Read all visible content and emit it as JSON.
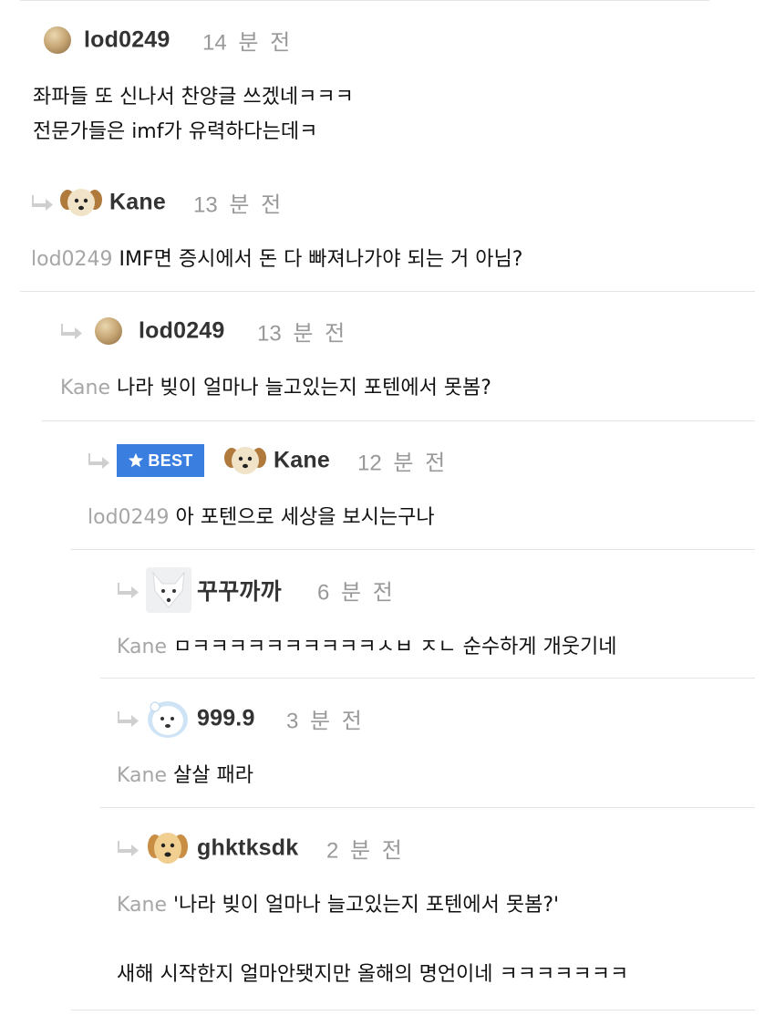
{
  "comments": [
    {
      "username": "lod0249",
      "time": "14 분 전",
      "lines": [
        "좌파들 또 신나서 찬양글 쓰겠네ㅋㅋㅋ",
        "전문가들은 imf가 유력하다는데ㅋ"
      ]
    },
    {
      "username": "Kane",
      "time": "13 분 전",
      "mention": "lod0249",
      "text": "IMF면 증시에서 돈 다 빠져나가야 되는 거 아님?"
    },
    {
      "username": "lod0249",
      "time": "13 분 전",
      "mention": "Kane",
      "text": "나라 빚이 얼마나 늘고있는지 포텐에서 못봄?"
    },
    {
      "badge": "BEST",
      "username": "Kane",
      "time": "12 분 전",
      "mention": "lod0249",
      "text": "아 포텐으로 세상을 보시는구나"
    },
    {
      "username": "꾸꾸까까",
      "time": "6 분 전",
      "mention": "Kane",
      "text": "ㅁㅋㅋㅋㅋㅋㅋㅋㅋㅋㅋㅅㅂ ㅈㄴ 순수하게 개웃기네"
    },
    {
      "username": "999.9",
      "time": "3 분 전",
      "mention": "Kane",
      "text": "살살 패라"
    },
    {
      "username": "ghktksdk",
      "time": "2 분 전",
      "mention": "Kane",
      "text": "'나라 빚이 얼마나 늘고있는지 포텐에서 못봄?'",
      "extra": "새해 시작한지 얼마안됏지만 올해의 명언이네 ㅋㅋㅋㅋㅋㅋㅋ"
    }
  ],
  "icons": {
    "reply": "reply-arrow-icon",
    "best": "star-icon"
  },
  "colors": {
    "best_badge": "#3a7fe0",
    "mention": "#a6a6a6",
    "time": "#999999",
    "reply_arrow": "#cfcfcf"
  }
}
